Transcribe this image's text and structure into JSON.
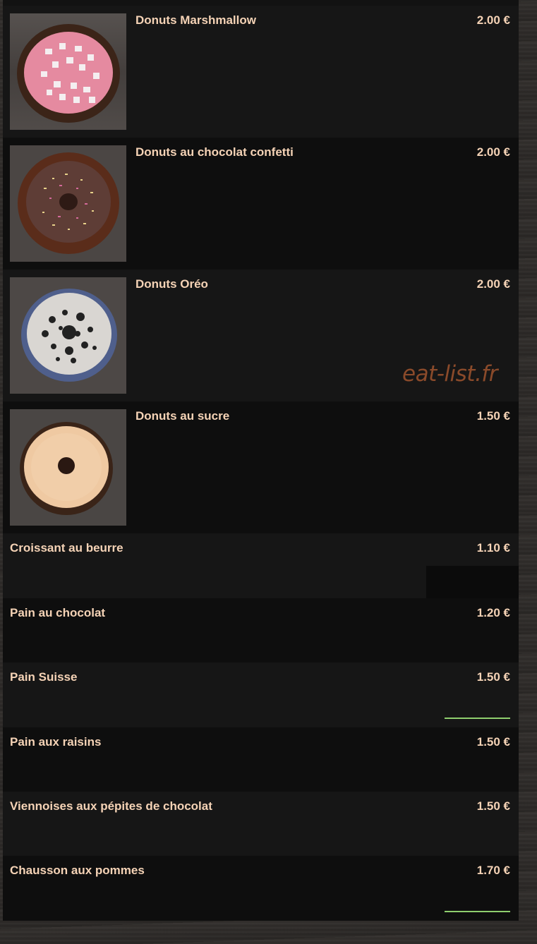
{
  "items": [
    {
      "name": "Donuts Marshmallow",
      "price": "2.00 €"
    },
    {
      "name": "Donuts au chocolat confetti",
      "price": "2.00 €"
    },
    {
      "name": "Donuts Oréo",
      "price": "2.00 €"
    },
    {
      "name": "Donuts au sucre",
      "price": "1.50 €"
    },
    {
      "name": "Croissant au beurre",
      "price": "1.10 €"
    },
    {
      "name": "Pain au chocolat",
      "price": "1.20 €"
    },
    {
      "name": "Pain Suisse",
      "price": "1.50 €"
    },
    {
      "name": "Pain aux raisins",
      "price": "1.50 €"
    },
    {
      "name": "Viennoises aux pépites de chocolat",
      "price": "1.50 €"
    },
    {
      "name": "Chausson aux pommes",
      "price": "1.70 €"
    }
  ],
  "watermark": "eat-list.fr",
  "colors": {
    "text": "#f5d3b6",
    "row_light": "#161616",
    "row_dark": "#0e0e0e",
    "accent_line": "#8fcf6e",
    "watermark": "#8a4a2a"
  },
  "images": [
    "pink-marshmallow-donut",
    "chocolate-confetti-donut",
    "oreo-donut",
    "sugar-donut"
  ]
}
